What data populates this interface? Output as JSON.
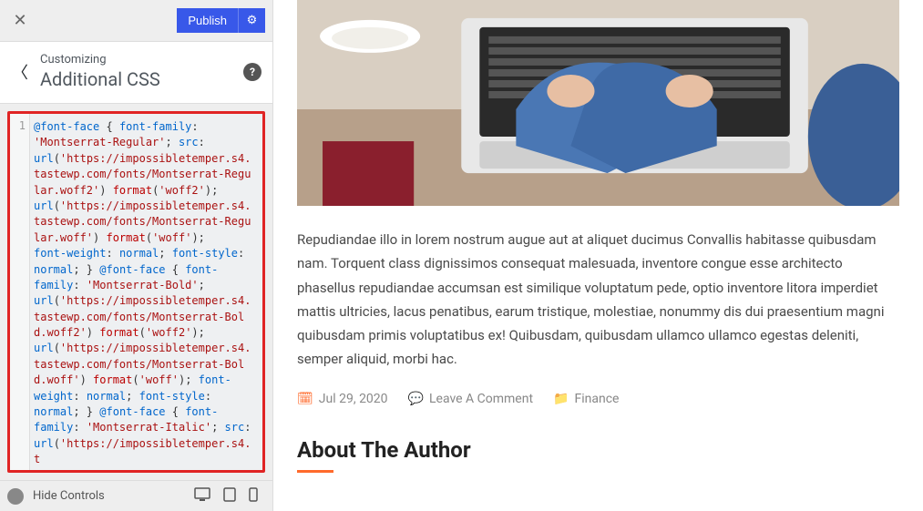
{
  "topbar": {
    "publish_label": "Publish"
  },
  "header": {
    "crumb": "Customizing",
    "title": "Additional CSS"
  },
  "editor": {
    "line_no": "1",
    "tokens": [
      {
        "t": "@font-face",
        "c": "k-blue"
      },
      {
        "t": " { "
      },
      {
        "t": "font-family",
        "c": "k-blue"
      },
      {
        "t": ":\n"
      },
      {
        "t": "'Montserrat-Regular'",
        "c": "k-str"
      },
      {
        "t": "; "
      },
      {
        "t": "src",
        "c": "k-blue"
      },
      {
        "t": ":\n"
      },
      {
        "t": "url",
        "c": "k-blue"
      },
      {
        "t": "("
      },
      {
        "t": "'https://impossibletemper.s4.tastewp.com/fonts/Montserrat-Regular.woff2'",
        "c": "k-str"
      },
      {
        "t": ") "
      },
      {
        "t": "format",
        "c": "k-red"
      },
      {
        "t": "("
      },
      {
        "t": "'woff2'",
        "c": "k-str"
      },
      {
        "t": ");\n"
      },
      {
        "t": "url",
        "c": "k-blue"
      },
      {
        "t": "("
      },
      {
        "t": "'https://impossibletemper.s4.tastewp.com/fonts/Montserrat-Regular.woff'",
        "c": "k-str"
      },
      {
        "t": ") "
      },
      {
        "t": "format",
        "c": "k-red"
      },
      {
        "t": "("
      },
      {
        "t": "'woff'",
        "c": "k-str"
      },
      {
        "t": ");\n"
      },
      {
        "t": "font-weight",
        "c": "k-blue"
      },
      {
        "t": ": "
      },
      {
        "t": "normal",
        "c": "k-blue"
      },
      {
        "t": "; "
      },
      {
        "t": "font-style",
        "c": "k-blue"
      },
      {
        "t": ":\n"
      },
      {
        "t": "normal",
        "c": "k-blue"
      },
      {
        "t": "; } "
      },
      {
        "t": "@font-face",
        "c": "k-blue"
      },
      {
        "t": " { "
      },
      {
        "t": "font-\nfamily",
        "c": "k-blue"
      },
      {
        "t": ": "
      },
      {
        "t": "'Montserrat-Bold'",
        "c": "k-str"
      },
      {
        "t": ";\n"
      },
      {
        "t": "url",
        "c": "k-blue"
      },
      {
        "t": "("
      },
      {
        "t": "'https://impossibletemper.s4.tastewp.com/fonts/Montserrat-Bold.woff2'",
        "c": "k-str"
      },
      {
        "t": ") "
      },
      {
        "t": "format",
        "c": "k-red"
      },
      {
        "t": "("
      },
      {
        "t": "'woff2'",
        "c": "k-str"
      },
      {
        "t": ");\n"
      },
      {
        "t": "url",
        "c": "k-blue"
      },
      {
        "t": "("
      },
      {
        "t": "'https://impossibletemper.s4.tastewp.com/fonts/Montserrat-Bold.woff'",
        "c": "k-str"
      },
      {
        "t": ") "
      },
      {
        "t": "format",
        "c": "k-red"
      },
      {
        "t": "("
      },
      {
        "t": "'woff'",
        "c": "k-str"
      },
      {
        "t": "); "
      },
      {
        "t": "font-\nweight",
        "c": "k-blue"
      },
      {
        "t": ": "
      },
      {
        "t": "normal",
        "c": "k-blue"
      },
      {
        "t": "; "
      },
      {
        "t": "font-style",
        "c": "k-blue"
      },
      {
        "t": ":\n"
      },
      {
        "t": "normal",
        "c": "k-blue"
      },
      {
        "t": "; } "
      },
      {
        "t": "@font-face",
        "c": "k-blue"
      },
      {
        "t": " { "
      },
      {
        "t": "font-\nfamily",
        "c": "k-blue"
      },
      {
        "t": ": "
      },
      {
        "t": "'Montserrat-Italic'",
        "c": "k-str"
      },
      {
        "t": "; "
      },
      {
        "t": "src",
        "c": "k-blue"
      },
      {
        "t": ":\n"
      },
      {
        "t": "url",
        "c": "k-blue"
      },
      {
        "t": "("
      },
      {
        "t": "'https://impossibletemper.s4.t",
        "c": "k-str"
      }
    ]
  },
  "footer": {
    "hide_label": "Hide Controls"
  },
  "article": {
    "body": "Repudiandae illo in lorem nostrum augue aut at aliquet ducimus Convallis habitasse quibusdam nam. Torquent class dignissimos consequat malesuada, inventore congue esse architecto phasellus repudiandae accumsan est similique voluptatum pede, optio inventore litora imperdiet mattis ultricies, lacus penatibus, earum tristique, molestiae, nonummy dis dui praesentium magni quibusdam primis voluptatibus ex! Quibusdam, quibusdam ullamco ullamco egestas deleniti, semper aliquid, morbi hac.",
    "date": "Jul 29, 2020",
    "comments": "Leave A Comment",
    "category": "Finance",
    "author_heading": "About The Author"
  }
}
